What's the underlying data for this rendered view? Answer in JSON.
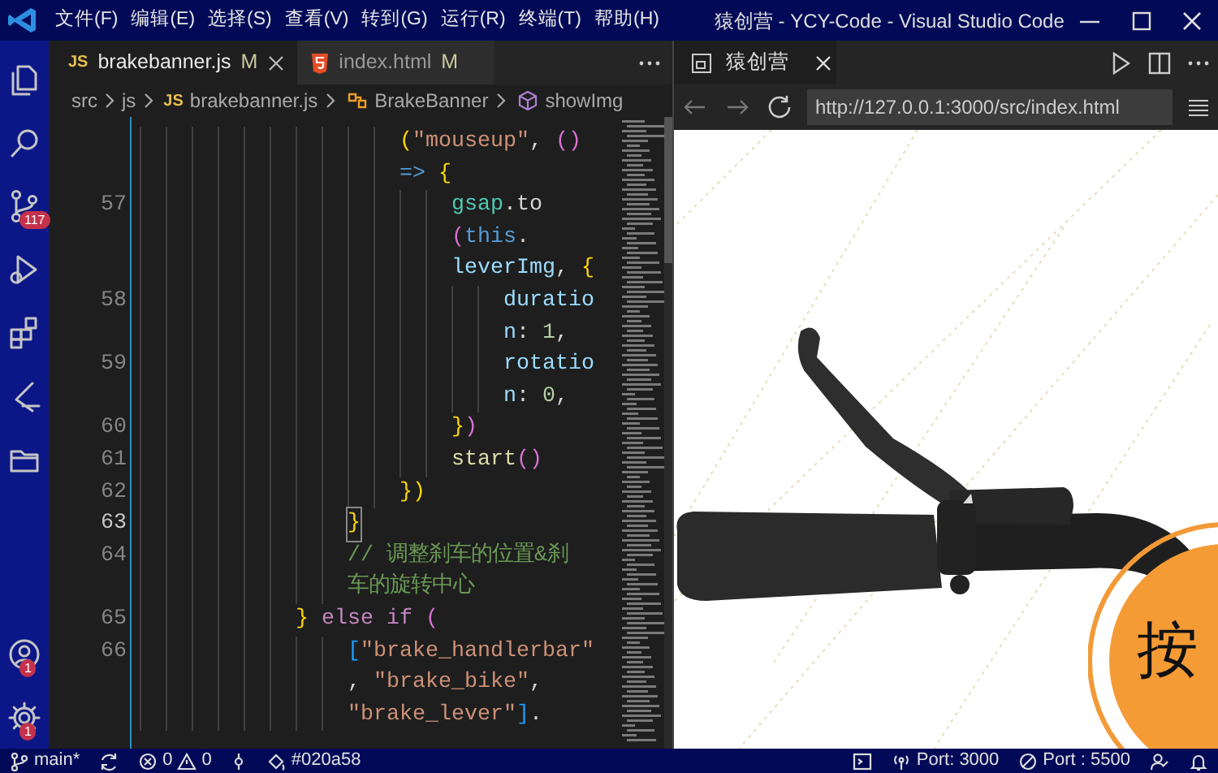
{
  "title_bar": {
    "menus": [
      "文件(F)",
      "编辑(E)",
      "选择(S)",
      "查看(V)",
      "转到(G)",
      "运行(R)",
      "终端(T)",
      "帮助(H)"
    ],
    "title": "猿创营 - YCY-Code - Visual Studio Code"
  },
  "activity_bar": {
    "top_items": [
      {
        "kind": "explorer"
      },
      {
        "kind": "search"
      },
      {
        "kind": "source-control",
        "badge": "117"
      },
      {
        "kind": "run"
      },
      {
        "kind": "extensions"
      },
      {
        "kind": "remote"
      },
      {
        "kind": "folder"
      }
    ],
    "bottom_items": [
      {
        "kind": "account",
        "badge": "1"
      },
      {
        "kind": "settings",
        "badge": "1"
      }
    ]
  },
  "editor": {
    "tabs": [
      {
        "kind": "js",
        "icon_text": "JS",
        "label": "brakebanner.js",
        "status": "M",
        "selected": true
      },
      {
        "kind": "html",
        "label": "index.html",
        "status": "M",
        "selected": false
      }
    ],
    "breadcrumb": [
      {
        "kind": "folder",
        "label": "src"
      },
      {
        "kind": "folder",
        "label": "js"
      },
      {
        "kind": "js",
        "icon_text": "JS",
        "label": "brakebanner.js"
      },
      {
        "kind": "class",
        "label": "BrakeBanner"
      },
      {
        "kind": "method",
        "label": "showImg"
      }
    ],
    "lines": [
      {
        "current": false,
        "tokens": [
          {
            "text": "                    (",
            "kind": "bracket1"
          },
          {
            "text": "\"mouseup\"",
            "kind": "string"
          },
          {
            "text": ", ",
            "kind": "plain"
          },
          {
            "text": "()",
            "kind": "bracket2"
          }
        ]
      },
      {
        "current": false,
        "tokens": [
          {
            "text": "                    => ",
            "kind": "keyword"
          },
          {
            "text": "{",
            "kind": "bracket1"
          }
        ]
      },
      {
        "number": "57",
        "current": false,
        "tokens": [
          {
            "text": "                        gsap",
            "kind": "type"
          },
          {
            "text": ".to",
            "kind": "plain"
          }
        ]
      },
      {
        "current": false,
        "tokens": [
          {
            "text": "                        (",
            "kind": "bracket2"
          },
          {
            "text": "this",
            "kind": "keyword"
          },
          {
            "text": ".",
            "kind": "plain"
          }
        ]
      },
      {
        "current": false,
        "tokens": [
          {
            "text": "                        leverImg",
            "kind": "property"
          },
          {
            "text": ", ",
            "kind": "plain"
          },
          {
            "text": "{",
            "kind": "bracket1"
          }
        ]
      },
      {
        "number": "58",
        "current": false,
        "tokens": [
          {
            "text": "                            duratio",
            "kind": "property"
          }
        ]
      },
      {
        "current": false,
        "tokens": [
          {
            "text": "                            n",
            "kind": "property"
          },
          {
            "text": ": ",
            "kind": "plain"
          },
          {
            "text": "1",
            "kind": "number"
          },
          {
            "text": ",",
            "kind": "plain"
          }
        ]
      },
      {
        "number": "59",
        "current": false,
        "tokens": [
          {
            "text": "                            rotatio",
            "kind": "property"
          }
        ]
      },
      {
        "current": false,
        "tokens": [
          {
            "text": "                            n",
            "kind": "property"
          },
          {
            "text": ": ",
            "kind": "plain"
          },
          {
            "text": "0",
            "kind": "number"
          },
          {
            "text": ",",
            "kind": "plain"
          }
        ]
      },
      {
        "number": "60",
        "current": false,
        "tokens": [
          {
            "text": "                        }",
            "kind": "bracket1"
          },
          {
            "text": ")",
            "kind": "bracket2"
          }
        ]
      },
      {
        "number": "61",
        "current": false,
        "tokens": [
          {
            "text": "                        start",
            "kind": "function"
          },
          {
            "text": "()",
            "kind": "bracket2"
          }
        ]
      },
      {
        "number": "62",
        "current": false,
        "tokens": [
          {
            "text": "                    })",
            "kind": "bracket1"
          }
        ]
      },
      {
        "number": "63",
        "current": true,
        "tokens": [
          {
            "text": "                }",
            "kind": "bracket1"
          }
        ]
      },
      {
        "number": "64",
        "current": false,
        "tokens": [
          {
            "text": "                // 调整刹车的位置&刹",
            "kind": "comment"
          }
        ]
      },
      {
        "current": false,
        "tokens": [
          {
            "text": "                车的旋转中心",
            "kind": "comment"
          }
        ]
      },
      {
        "number": "65",
        "current": false,
        "tokens": [
          {
            "text": "            }",
            "kind": "bracket1"
          },
          {
            "text": " else if ",
            "kind": "control"
          },
          {
            "text": "(",
            "kind": "bracket2"
          }
        ]
      },
      {
        "number": "66",
        "current": false,
        "tokens": [
          {
            "text": "                [",
            "kind": "bracket3"
          },
          {
            "text": "\"brake_handlerbar\"",
            "kind": "string"
          }
        ]
      },
      {
        "current": false,
        "tokens": [
          {
            "text": "                , ",
            "kind": "plain"
          },
          {
            "text": "\"brake_bike\"",
            "kind": "string"
          },
          {
            "text": ",",
            "kind": "plain"
          }
        ]
      },
      {
        "current": false,
        "tokens": [
          {
            "text": "                \"brake_lever\"",
            "kind": "string"
          },
          {
            "text": "]",
            "kind": "bracket3"
          },
          {
            "text": ".",
            "kind": "plain"
          }
        ]
      }
    ]
  },
  "preview": {
    "tab": {
      "label": "猿创营"
    },
    "url": "http://127.0.0.1:3000/src/index.html",
    "page": {
      "button_text": "按"
    }
  },
  "status_bar": {
    "branch": "main*",
    "errors": "0",
    "warnings": "0",
    "color_label": "#020a58",
    "ports": [
      {
        "kind": "broadcast",
        "label": "Port: 3000"
      },
      {
        "kind": "blocked",
        "label": "Port : 5500"
      }
    ]
  }
}
